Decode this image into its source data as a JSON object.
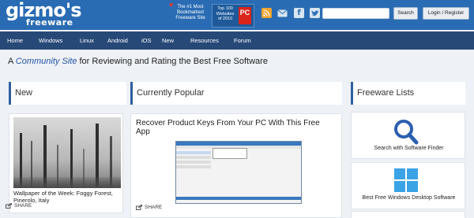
{
  "header": {
    "logo_line1": "gizmo's",
    "logo_line2": "freeware",
    "award1": "The #1 Most Bookmarked Freeware Site",
    "award2": "Top 100 Websites of 2010",
    "award2_badge": "PC",
    "search_placeholder": "",
    "search_button": "Search",
    "login_button": "Login / Register",
    "social_icons": [
      "rss-icon",
      "mail-icon",
      "facebook-icon",
      "twitter-icon"
    ],
    "colors": {
      "header": "#2a6cb3",
      "nav": "#274977",
      "accent": "#2d5f9f"
    }
  },
  "nav": {
    "items": [
      "Home",
      "Windows",
      "Linux",
      "Android",
      "iOS",
      "New",
      "Resources",
      "Forum"
    ]
  },
  "tagline": {
    "prefix": "A",
    "highlight": "Community Site",
    "suffix": "for Reviewing and Rating the Best Free Software"
  },
  "sections": {
    "new": "New",
    "popular": "Currently Popular",
    "freeware": "Freeware Lists"
  },
  "new_card": {
    "title": "Wallpaper of the Week: Foggy Forest, Pinerolo, Italy",
    "share": "SHARE"
  },
  "popular_card": {
    "title": "Recover Product Keys From Your PC With This Free App",
    "share": "SHARE"
  },
  "freeware_lists": [
    {
      "label": "Search with Software Finder",
      "icon": "magnifier-icon"
    },
    {
      "label": "Best Free Windows Desktop Software",
      "icon": "windows-logo-icon"
    }
  ]
}
